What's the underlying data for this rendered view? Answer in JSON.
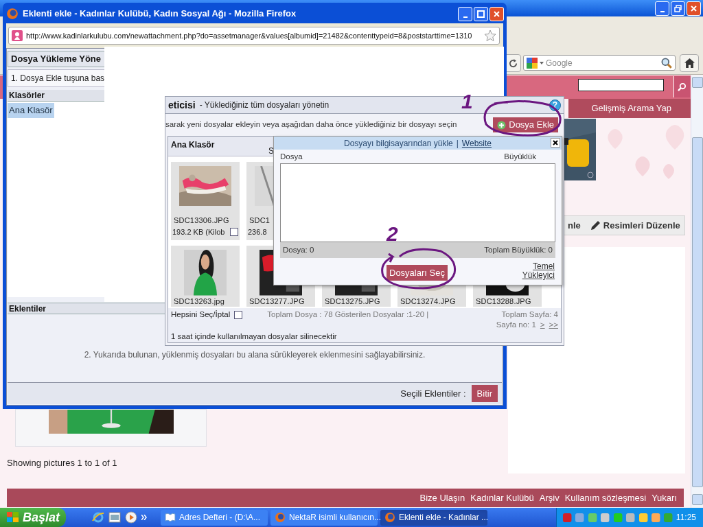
{
  "back_window": {
    "search_box": {
      "placeholder": "Google"
    },
    "site": {
      "advanced_search": "Gelişmiş Arama Yap",
      "edit_fragment": "nle",
      "edit_pictures": "Resimleri Düzenle",
      "showing": "Showing pictures 1 to 1 of 1",
      "footer_links": [
        "Bize Ulaşın",
        "Kadınlar Kulübü",
        "Arşiv",
        "Kullanım sözleşmesi",
        "Yukarı"
      ]
    }
  },
  "popup": {
    "title": "Eklenti ekle - Kadınlar Kulübü, Kadın Sosyal Ağı - Mozilla Firefox",
    "url": "http://www.kadinlarkulubu.com/newattachment.php?do=assetmanager&values[albumid]=21482&contenttypeid=8&poststarttime=1310",
    "left_panel": {
      "header": "Dosya Yükleme Yöne",
      "step": "1. Dosya Ekle tuşuna bas",
      "folders_header": "Klasörler",
      "folders": [
        {
          "label": "Ana Klasör",
          "selected": true
        }
      ]
    },
    "attachments": {
      "header": "Eklentiler",
      "hint": "2. Yukarıda bulunan, yüklenmiş dosyaları bu alana sürükleyerek eklenmesini sağlayabilirsiniz."
    },
    "footer": {
      "label": "Seçili Eklentiler :",
      "button": "Bitir"
    }
  },
  "asset_manager": {
    "title": "eticisi",
    "subtitle": "- Yüklediğiniz tüm dosyaları yönetin",
    "help": "?",
    "instruction": "sarak yeni dosyalar ekleyin veya aşağıdan daha önce yüklediğiniz bir dosyayı seçin",
    "add_button": "Dosya Ekle",
    "folder_title": "Ana Klasör",
    "column_fragment": "S",
    "file_rows": [
      [
        {
          "name": "SDC13306.JPG",
          "size": "193.2 KB (Kilob",
          "checked": false
        },
        {
          "name": "SDC1",
          "size": "236.8"
        }
      ],
      [
        {
          "name": "SDC13263.jpg"
        },
        {
          "name": "SDC13277.JPG"
        },
        {
          "name": "SDC13275.JPG"
        },
        {
          "name": "SDC13274.JPG"
        },
        {
          "name": "SDC13288.JPG"
        }
      ]
    ],
    "select_all": {
      "label": "Hepsini Seç/İptal",
      "checked": false
    },
    "totals": "Toplam Dosya : 78 Gösterilen Dosyalar :1-20  |",
    "pages": "Toplam Sayfa: 4",
    "page_no": "Sayfa no: 1",
    "next": ">",
    "last": ">>",
    "notice": "1 saat içinde kullanılmayan dosyalar silinecektir"
  },
  "upload_dialog": {
    "tabs": [
      {
        "label": "Dosyayı bilgisayarından yükle",
        "selected": true
      },
      {
        "label": "Website",
        "selected": false
      }
    ],
    "separator": "|",
    "columns": [
      "Dosya",
      "Büyüklük"
    ],
    "count": "Dosya: 0",
    "total": "Toplam Büyüklük: 0",
    "select_button": "Dosyaları Seç",
    "basic_link": "Temel Yükleyici"
  },
  "annotations": [
    {
      "label": "1"
    },
    {
      "label": "2"
    }
  ],
  "taskbar": {
    "start": "Başlat",
    "tasks": [
      {
        "label": "Adres Defteri - (D:\\A...",
        "selected": false
      },
      {
        "label": "NektaR isimli kullanıcın...",
        "selected": false
      },
      {
        "label": "Eklenti ekle - Kadınlar ...",
        "selected": true
      }
    ],
    "clock": "11:25"
  }
}
